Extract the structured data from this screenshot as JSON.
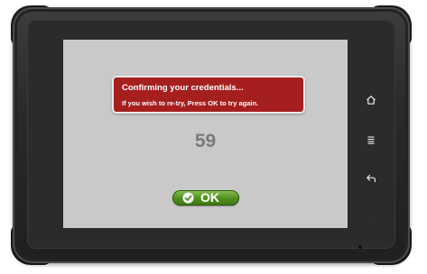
{
  "dialog": {
    "title": "Confirming your credentials...",
    "message": "If you wish to re-try, Press OK to try again."
  },
  "countdown": {
    "value": "59"
  },
  "ok_button": {
    "label": "OK",
    "icon": "check-circle-icon"
  },
  "hardware_keys": [
    {
      "name": "home",
      "icon": "home-icon"
    },
    {
      "name": "menu",
      "icon": "menu-icon"
    },
    {
      "name": "back",
      "icon": "back-arrow-icon"
    }
  ],
  "colors": {
    "dialog_background": "#a61f1f",
    "screen_background": "#c9c9c9",
    "countdown_text": "#7a7a7a",
    "ok_button_green": "#4f8f1d",
    "device_body": "#2b2b2b"
  }
}
